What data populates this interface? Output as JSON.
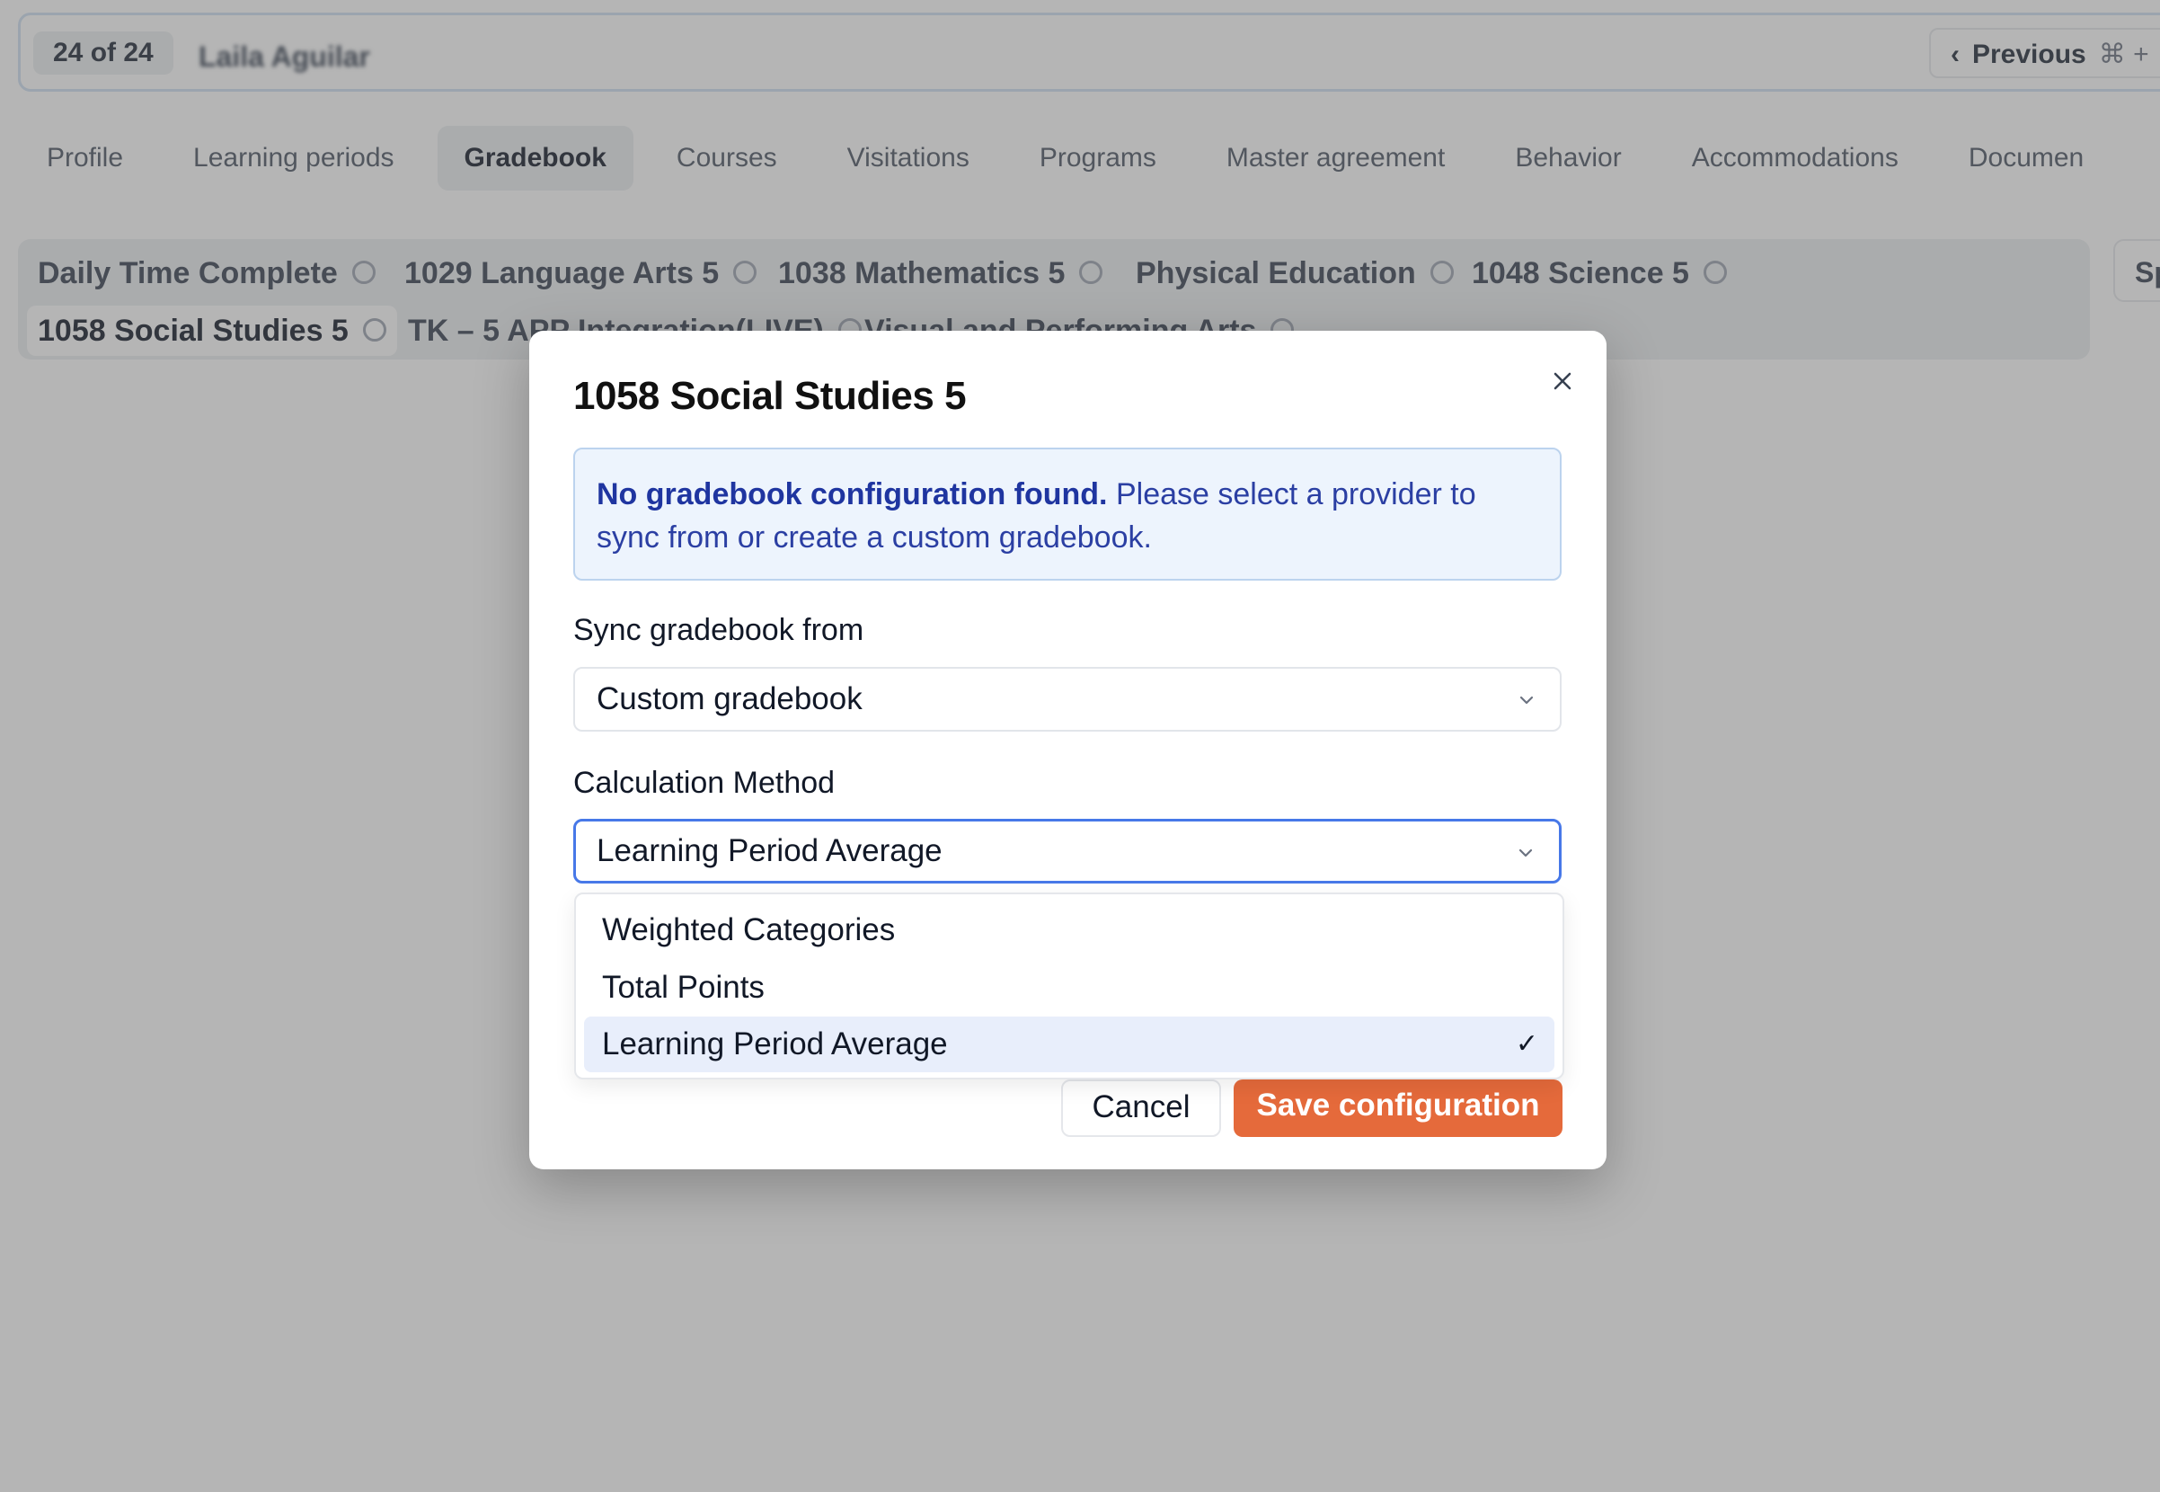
{
  "header": {
    "record_count": "24 of 24",
    "student_name": "Laila Aguilar",
    "previous_label": "Previous",
    "shortcut": "⌘ +"
  },
  "tabs": [
    {
      "label": "Profile"
    },
    {
      "label": "Learning periods"
    },
    {
      "label": "Gradebook",
      "active": true
    },
    {
      "label": "Courses"
    },
    {
      "label": "Visitations"
    },
    {
      "label": "Programs"
    },
    {
      "label": "Master agreement"
    },
    {
      "label": "Behavior"
    },
    {
      "label": "Accommodations"
    },
    {
      "label": "Documen"
    }
  ],
  "courses": [
    {
      "label": "Daily Time Complete"
    },
    {
      "label": "1029 Language Arts 5"
    },
    {
      "label": "1038 Mathematics 5"
    },
    {
      "label": "Physical Education"
    },
    {
      "label": "1048 Science 5"
    },
    {
      "label": "1058 Social Studies 5",
      "active": true
    },
    {
      "label": "TK – 5 APP Integration(LIVE)"
    },
    {
      "label": "Visual and Performing Arts"
    }
  ],
  "side_box_label": "Sp",
  "modal": {
    "title": "1058 Social Studies 5",
    "alert_strong": "No gradebook configuration found.",
    "alert_text": " Please select a provider to sync from or create a custom gradebook.",
    "sync_label": "Sync gradebook from",
    "sync_value": "Custom gradebook",
    "calc_label": "Calculation Method",
    "calc_value": "Learning Period Average",
    "options": [
      {
        "label": "Weighted Categories"
      },
      {
        "label": "Total Points"
      },
      {
        "label": "Learning Period Average",
        "selected": true
      }
    ],
    "cancel_label": "Cancel",
    "save_label": "Save configuration"
  },
  "colors": {
    "accent": "#e56a3b",
    "focus": "#4778e8",
    "alert_bg": "#edf4fd",
    "alert_text": "#2b3fa3"
  }
}
